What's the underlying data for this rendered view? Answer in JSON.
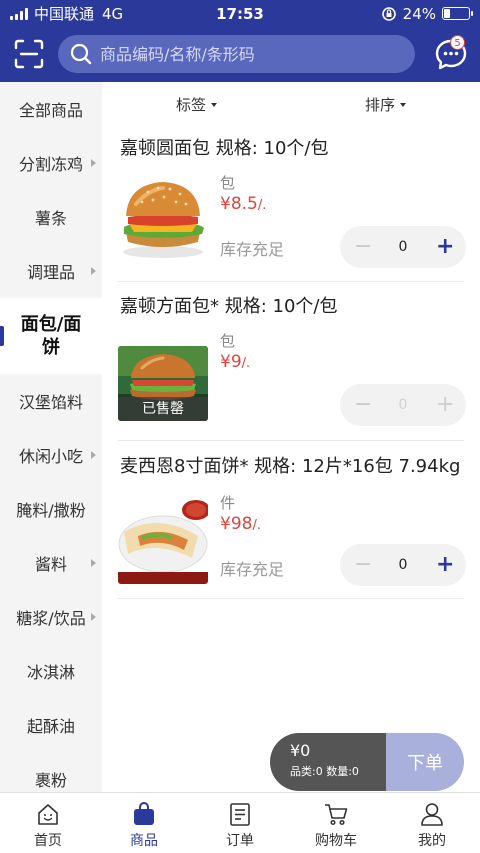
{
  "status": {
    "carrier": "中国联通",
    "network": "4G",
    "time": "17:53",
    "battery": "24%",
    "battery_level": 0.24
  },
  "header": {
    "search_placeholder": "商品编码/名称/条形码",
    "message_badge": "5",
    "scan_icon": "scan-icon",
    "message_icon": "chat-bubble-icon"
  },
  "sidebar": {
    "items": [
      {
        "label": "全部商品",
        "arrow": false
      },
      {
        "label": "分割冻鸡",
        "arrow": true
      },
      {
        "label": "薯条",
        "arrow": false
      },
      {
        "label": "调理品",
        "arrow": true
      },
      {
        "label": "面包/面饼",
        "arrow": false,
        "active": true
      },
      {
        "label": "汉堡馅料",
        "arrow": false
      },
      {
        "label": "休闲小吃",
        "arrow": true
      },
      {
        "label": "腌料/撒粉",
        "arrow": false
      },
      {
        "label": "酱料",
        "arrow": true
      },
      {
        "label": "糖浆/饮品",
        "arrow": true
      },
      {
        "label": "冰淇淋",
        "arrow": false
      },
      {
        "label": "起酥油",
        "arrow": false
      },
      {
        "label": "裹粉",
        "arrow": false
      }
    ]
  },
  "filters": {
    "tag": "标签",
    "sort": "排序"
  },
  "products": [
    {
      "name": "嘉顿圆面包 规格: 10个/包",
      "unit": "包",
      "price": "¥8.5",
      "price_suffix": "/.",
      "stock": "库存充足",
      "qty": "0",
      "sold_out": false,
      "image": "burger-image"
    },
    {
      "name": "嘉顿方面包* 规格: 10个/包",
      "unit": "包",
      "price": "¥9",
      "price_suffix": "/.",
      "stock": "",
      "qty": "0",
      "sold_out": true,
      "sold_out_label": "已售罄",
      "image": "sandwich-image"
    },
    {
      "name": "麦西恩8寸面饼* 规格: 12片*16包 7.94kg",
      "unit": "件",
      "price": "¥98",
      "price_suffix": "/.",
      "stock": "库存充足",
      "qty": "0",
      "sold_out": false,
      "image": "wrap-image"
    }
  ],
  "cart": {
    "total": "¥0",
    "summary": "品类:0 数量:0",
    "order_label": "下单"
  },
  "nav": {
    "items": [
      {
        "label": "首页",
        "icon": "home-icon"
      },
      {
        "label": "商品",
        "icon": "bag-icon",
        "active": true
      },
      {
        "label": "订单",
        "icon": "order-list-icon"
      },
      {
        "label": "购物车",
        "icon": "cart-icon"
      },
      {
        "label": "我的",
        "icon": "user-icon"
      }
    ]
  },
  "colors": {
    "brand": "#2b3a9a",
    "price": "#e0443c",
    "order_button": "#a9b0dc"
  }
}
